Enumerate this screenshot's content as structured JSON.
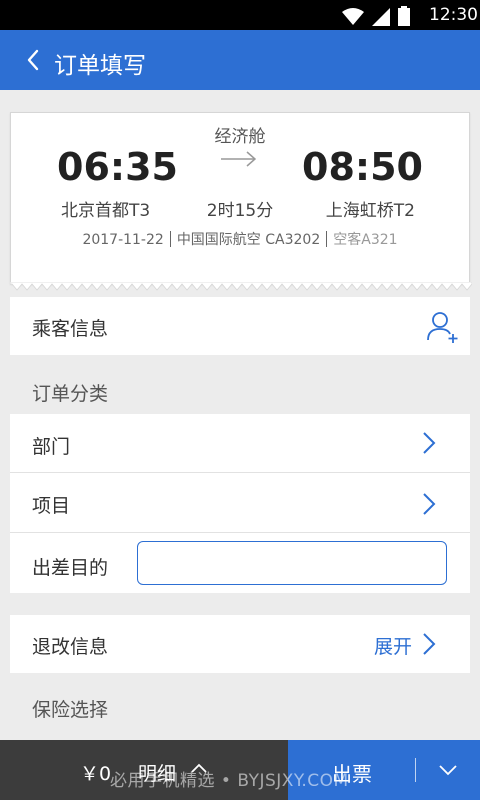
{
  "status": {
    "time": "12:30"
  },
  "header": {
    "title": "订单填写"
  },
  "flight": {
    "cabin_class": "经济舱",
    "departure_time": "06:35",
    "arrival_time": "08:50",
    "departure_airport": "北京首都T3",
    "arrival_airport": "上海虹桥T2",
    "duration": "2时15分",
    "date": "2017-11-22",
    "airline_flight": "中国国际航空 CA3202",
    "aircraft": "空客A321"
  },
  "passenger": {
    "label": "乘客信息"
  },
  "order_category": {
    "section_label": "订单分类",
    "department_label": "部门",
    "project_label": "项目",
    "purpose_label": "出差目的",
    "purpose_value": ""
  },
  "refund": {
    "label": "退改信息",
    "expand_label": "展开"
  },
  "insurance": {
    "section_label": "保险选择"
  },
  "bottom": {
    "price": "￥0",
    "detail_label": "明细",
    "issue_label": "出票"
  },
  "watermark": "必用手机精选 • BYJSJXY.COM",
  "colors": {
    "primary": "#2d6fd3",
    "bottom_dark": "#3c3c3c",
    "background": "#ececec"
  }
}
